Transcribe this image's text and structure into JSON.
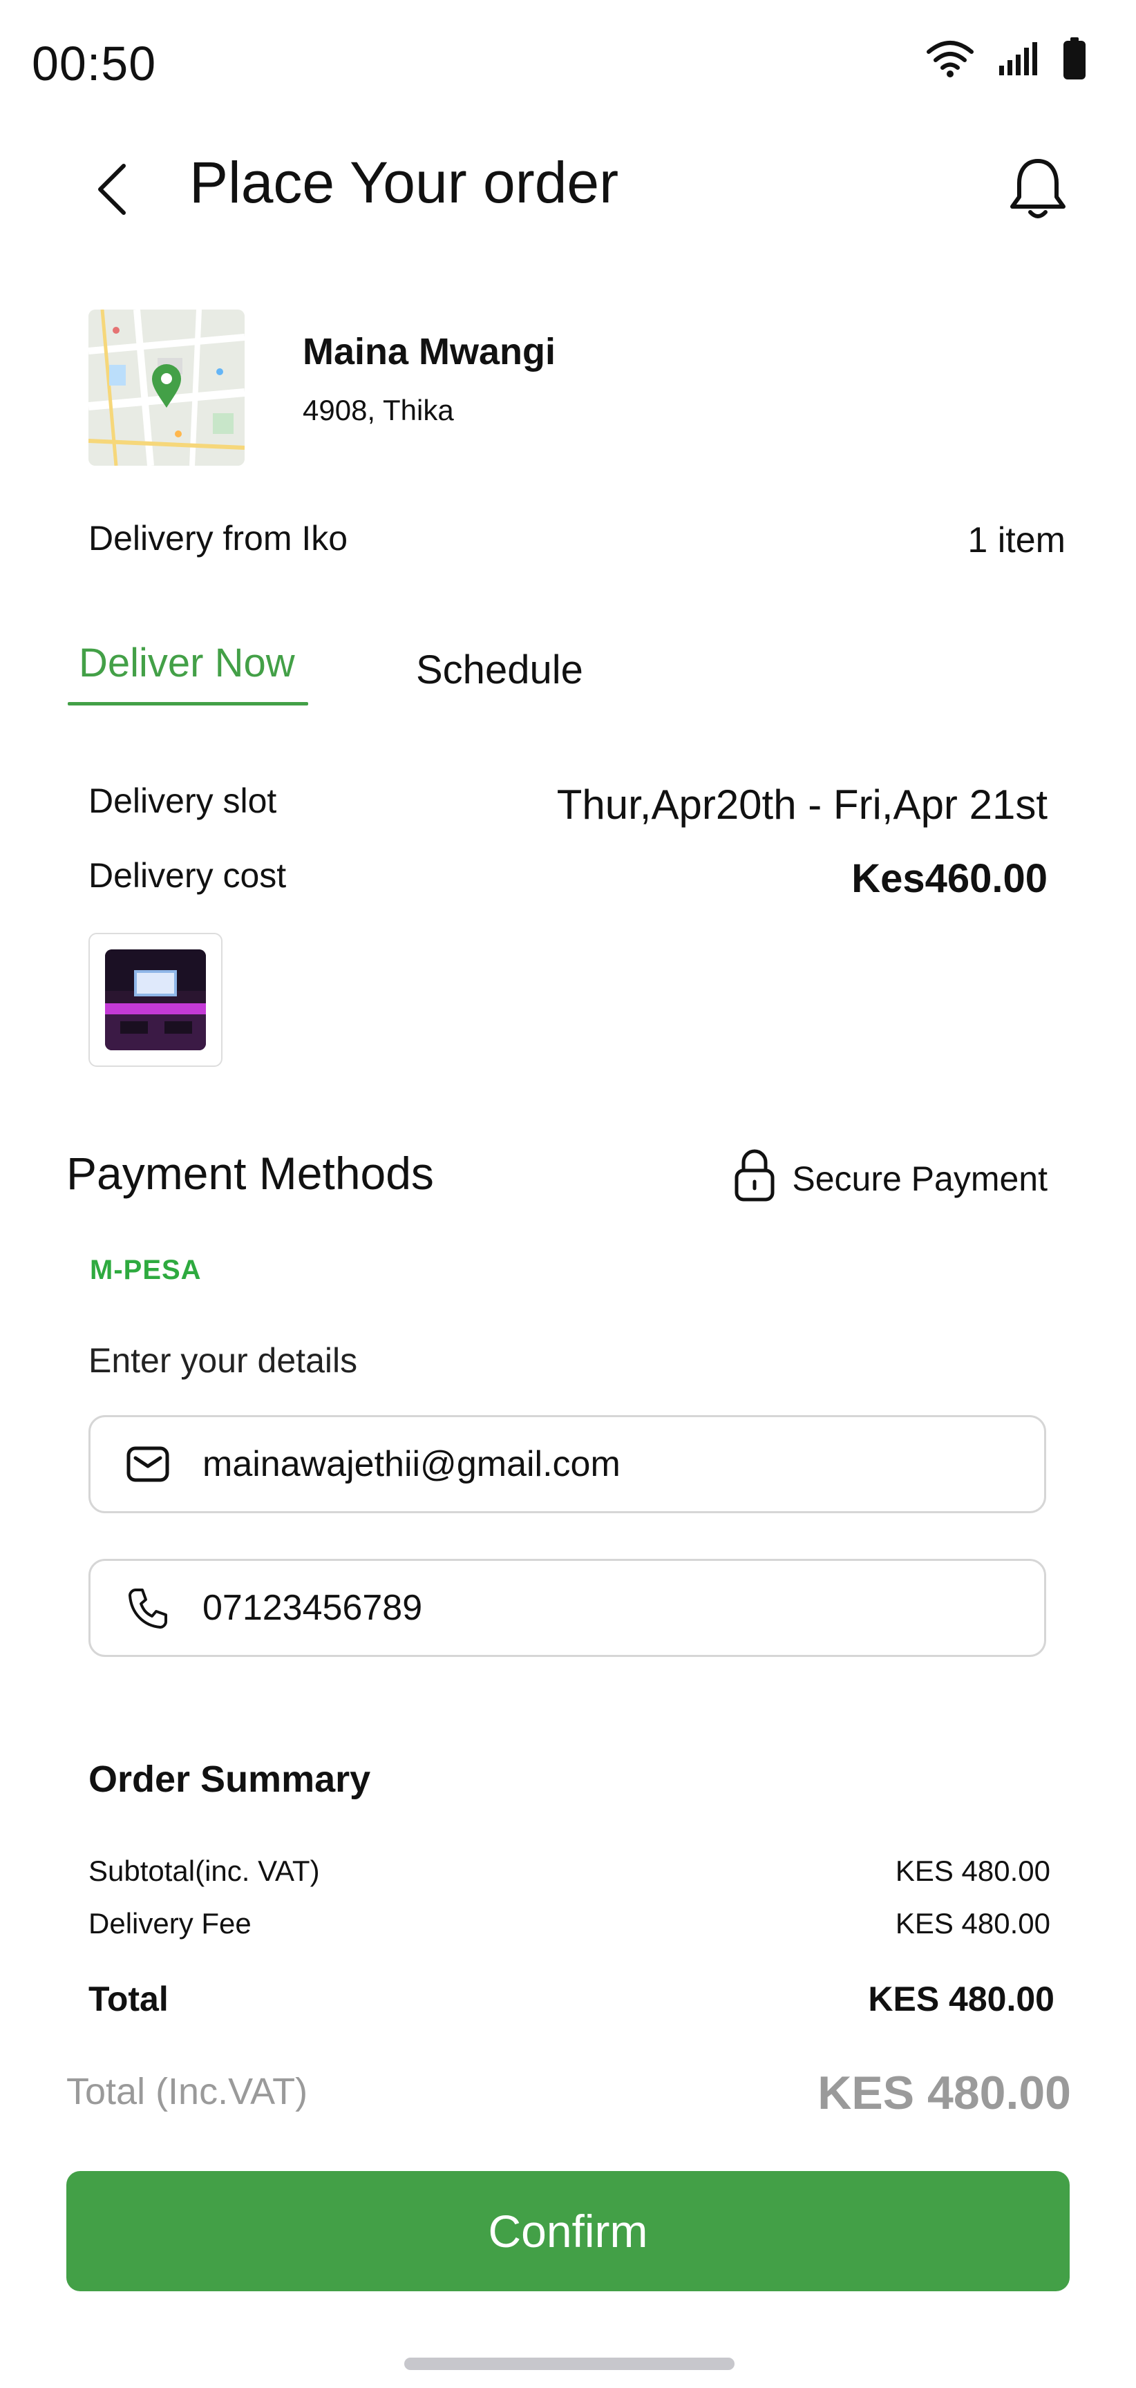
{
  "status_bar": {
    "time": "00:50",
    "icons": [
      "wifi-icon",
      "signal-icon",
      "battery-icon"
    ]
  },
  "header": {
    "title": "Place Your order",
    "back_icon": "chevron-left-icon",
    "notification_icon": "bell-icon"
  },
  "address": {
    "map_icon": "map-pin-icon",
    "name": "Maina Mwangi",
    "detail": "4908, Thika"
  },
  "delivery": {
    "from": "Delivery from Iko",
    "item_count": "1 item"
  },
  "tabs": [
    {
      "label": "Deliver Now",
      "active": true
    },
    {
      "label": "Schedule",
      "active": false
    }
  ],
  "delivery_info": {
    "slot_label": "Delivery slot",
    "slot_value": "Thur,Apr20th - Fri,Apr 21st",
    "cost_label": "Delivery cost",
    "cost_value": "Kes460.00"
  },
  "payment": {
    "title": "Payment Methods",
    "secure_label": "Secure Payment",
    "secure_icon": "lock-icon",
    "method_logo": "M-PESA",
    "details_prompt": "Enter your details",
    "email": "mainawajethii@gmail.com",
    "phone": "07123456789"
  },
  "summary": {
    "title": "Order Summary",
    "subtotal_label": "Subtotal(inc. VAT)",
    "subtotal_value": "KES 480.00",
    "fee_label": "Delivery Fee",
    "fee_value": "KES 480.00",
    "total_label": "Total",
    "total_value": "KES 480.00",
    "incvat_label": "Total (Inc.VAT)",
    "incvat_value": "KES 480.00"
  },
  "confirm_label": "Confirm",
  "colors": {
    "accent": "#43a047",
    "muted": "#9a9a9a",
    "border": "#d6d6d6"
  }
}
